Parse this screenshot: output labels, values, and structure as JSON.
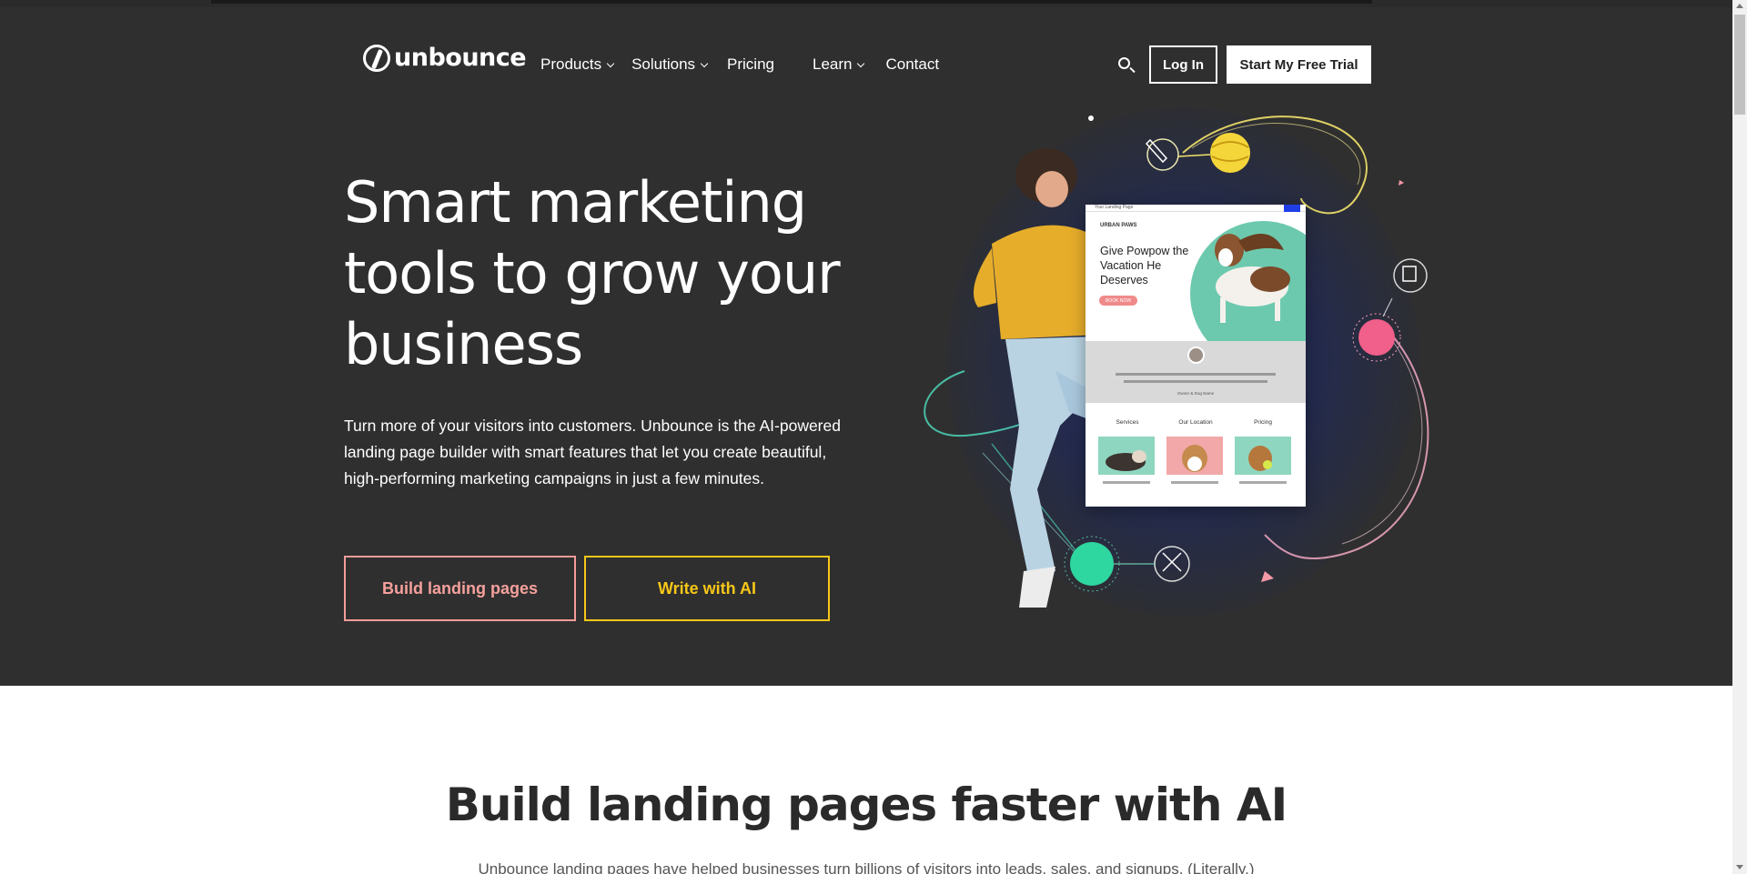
{
  "nav": {
    "logo_text": "unbounce",
    "links": [
      {
        "label": "Products",
        "dropdown": true
      },
      {
        "label": "Solutions",
        "dropdown": true
      },
      {
        "label": "Pricing",
        "dropdown": false
      },
      {
        "label": "Learn",
        "dropdown": true
      },
      {
        "label": "Contact",
        "dropdown": false
      }
    ],
    "search_icon": "search-icon",
    "login_label": "Log In",
    "trial_label": "Start My Free Trial"
  },
  "hero": {
    "title": "Smart marketing tools to grow your business",
    "description": "Turn more of your visitors into customers. Unbounce is the AI-powered landing page builder with smart features that let you create beautiful, high-performing marketing campaigns in just a few minutes.",
    "cta_primary": "Build landing pages",
    "cta_secondary": "Write with AI",
    "colors": {
      "background": "#2f2f2f",
      "cta_primary": "#f59c99",
      "cta_secondary": "#f7c718"
    }
  },
  "mockup": {
    "tab_label": "Your Landing Page",
    "brand": "URBAN PAWS",
    "heading": "Give Powpow the Vacation He Deserves",
    "book_button": "BOOK NOW",
    "caption": "Owner & Dog Name",
    "columns": [
      "Services",
      "Our Location",
      "Pricing"
    ]
  },
  "section2": {
    "title": "Build landing pages faster with AI",
    "description": "Unbounce landing pages have helped businesses turn billions of visitors into leads, sales, and signups. (Literally.)"
  }
}
